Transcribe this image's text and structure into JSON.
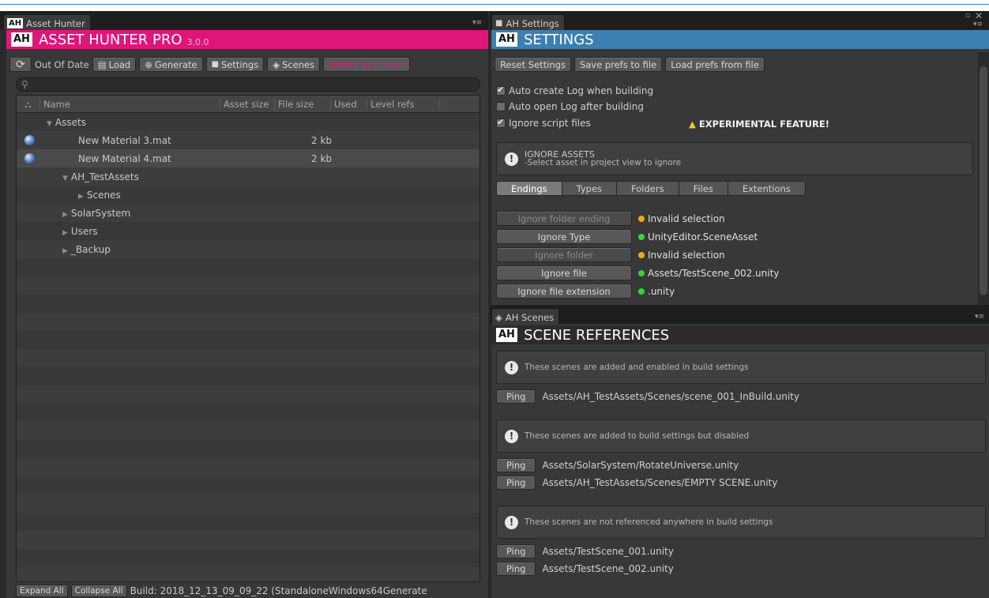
{
  "colors": {
    "pink_header": "#e0157a",
    "blue_header": "#3c7fb1",
    "dark_header": "#2e2a2e",
    "status_invalid": "#f0a820",
    "status_valid": "#3ad23a",
    "delete_text": "#e0157a"
  },
  "asset_hunter": {
    "tab_title": "Asset Hunter",
    "header_title": "ASSET HUNTER PRO",
    "version": "3.0.0",
    "toolbar": {
      "refresh_icon": "refresh-icon",
      "out_of_date": "Out Of Date",
      "load": "Load",
      "generate": "Generate",
      "settings": "Settings",
      "scenes": "Scenes",
      "delete_all": "Delete ALL unused"
    },
    "search_placeholder": "",
    "columns": [
      "Name",
      "Asset size",
      "File size",
      "Used",
      "Level refs"
    ],
    "rows": [
      {
        "label": "Assets",
        "indent": 1,
        "expander": "▼",
        "size": "",
        "icon": false
      },
      {
        "label": "New Material 3.mat",
        "indent": 3,
        "expander": "",
        "size": "2 kb",
        "icon": true
      },
      {
        "label": "New Material 4.mat",
        "indent": 3,
        "expander": "",
        "size": "2 kb",
        "icon": true
      },
      {
        "label": "AH_TestAssets",
        "indent": 2,
        "expander": "▼",
        "size": "",
        "icon": false
      },
      {
        "label": "Scenes",
        "indent": 3,
        "expander": "▶",
        "size": "",
        "icon": false
      },
      {
        "label": "SolarSystem",
        "indent": 2,
        "expander": "▶",
        "size": "",
        "icon": false
      },
      {
        "label": "Users",
        "indent": 2,
        "expander": "▶",
        "size": "",
        "icon": false
      },
      {
        "label": "_Backup",
        "indent": 2,
        "expander": "▶",
        "size": "",
        "icon": false
      }
    ],
    "bottom": {
      "expand_all": "Expand All",
      "collapse_all": "Collapse All",
      "build_info": "Build: 2018_12_13_09_09_22 (StandaloneWindows64Generate"
    }
  },
  "settings": {
    "tab_title": "AH Settings",
    "header_title": "SETTINGS",
    "buttons": {
      "reset": "Reset Settings",
      "save": "Save prefs to file",
      "load": "Load prefs from file"
    },
    "checks": [
      {
        "label": "Auto create Log when building",
        "checked": true
      },
      {
        "label": "Auto open Log after building",
        "checked": false
      },
      {
        "label": "Ignore script files",
        "checked": true
      }
    ],
    "experimental": "EXPERIMENTAL FEATURE!",
    "ignore_box": {
      "title": "IGNORE ASSETS",
      "subtitle": "-Select asset in project view to ignore"
    },
    "tabs": [
      "Endings",
      "Types",
      "Folders",
      "Files",
      "Extentions"
    ],
    "ignore_rows": [
      {
        "button": "Ignore folder ending",
        "enabled": false,
        "status": "Invalid selection",
        "state": "invalid"
      },
      {
        "button": "Ignore Type",
        "enabled": true,
        "status": "UnityEditor.SceneAsset",
        "state": "valid"
      },
      {
        "button": "Ignore folder",
        "enabled": false,
        "status": "Invalid selection",
        "state": "invalid"
      },
      {
        "button": "Ignore file",
        "enabled": true,
        "status": "Assets/TestScene_002.unity",
        "state": "valid"
      },
      {
        "button": "Ignore file extension",
        "enabled": true,
        "status": ".unity",
        "state": "valid"
      }
    ]
  },
  "scenes": {
    "tab_title": "AH Scenes",
    "header_title": "SCENE REFERENCES",
    "ping_label": "Ping",
    "groups": [
      {
        "message": "These scenes are added and enabled in build settings",
        "items": [
          "Assets/AH_TestAssets/Scenes/scene_001_InBuild.unity"
        ]
      },
      {
        "message": "These scenes are added to build settings but disabled",
        "items": [
          "Assets/SolarSystem/RotateUniverse.unity",
          "Assets/AH_TestAssets/Scenes/EMPTY SCENE.unity"
        ]
      },
      {
        "message": "These scenes are not referenced anywhere in build settings",
        "items": [
          "Assets/TestScene_001.unity",
          "Assets/TestScene_002.unity"
        ]
      }
    ]
  }
}
